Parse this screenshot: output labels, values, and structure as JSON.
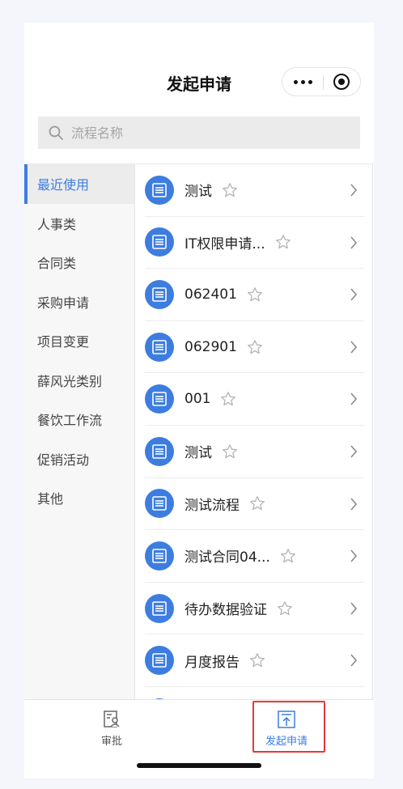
{
  "header": {
    "title": "发起申请"
  },
  "search": {
    "placeholder": "流程名称"
  },
  "sidebar": {
    "items": [
      {
        "label": "最近使用",
        "active": true
      },
      {
        "label": "人事类"
      },
      {
        "label": "合同类"
      },
      {
        "label": "采购申请"
      },
      {
        "label": "项目变更"
      },
      {
        "label": "薛风光类别"
      },
      {
        "label": "餐饮工作流"
      },
      {
        "label": "促销活动"
      },
      {
        "label": "其他"
      }
    ]
  },
  "processes": [
    {
      "label": "测试"
    },
    {
      "label": "IT权限申请..."
    },
    {
      "label": "062401"
    },
    {
      "label": "062901"
    },
    {
      "label": "001"
    },
    {
      "label": "测试"
    },
    {
      "label": "测试流程"
    },
    {
      "label": "测试合同04..."
    },
    {
      "label": "待办数据验证"
    },
    {
      "label": "月度报告"
    },
    {
      "label": ""
    }
  ],
  "tabbar": {
    "approve_label": "审批",
    "apply_label": "发起申请"
  },
  "colors": {
    "accent": "#3d7de0",
    "highlight": "#e53935"
  }
}
